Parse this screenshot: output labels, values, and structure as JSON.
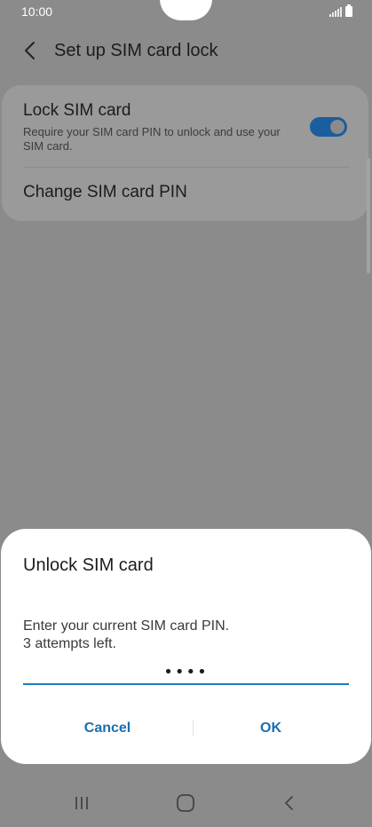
{
  "status_bar": {
    "time": "10:00"
  },
  "header": {
    "back_icon": "chevron-left-icon",
    "title": "Set up SIM card lock"
  },
  "settings": {
    "lock_sim": {
      "title": "Lock SIM card",
      "description": "Require your SIM card PIN to unlock and use your SIM card.",
      "toggle_on": true
    },
    "change_pin": {
      "label": "Change SIM card PIN"
    }
  },
  "dialog": {
    "title": "Unlock SIM card",
    "message_line1": "Enter your current SIM card PIN.",
    "message_line2": "3 attempts left.",
    "pin_value": "••••",
    "cancel_label": "Cancel",
    "ok_label": "OK"
  },
  "nav_bar": {
    "recents_icon": "recents-icon",
    "home_icon": "home-icon",
    "back_icon": "back-icon"
  },
  "colors": {
    "accent": "#1b7bc0",
    "toggle_on": "#1b5ea0",
    "scrim_background": "#8b8b8b",
    "dialog_background": "#ffffff"
  }
}
